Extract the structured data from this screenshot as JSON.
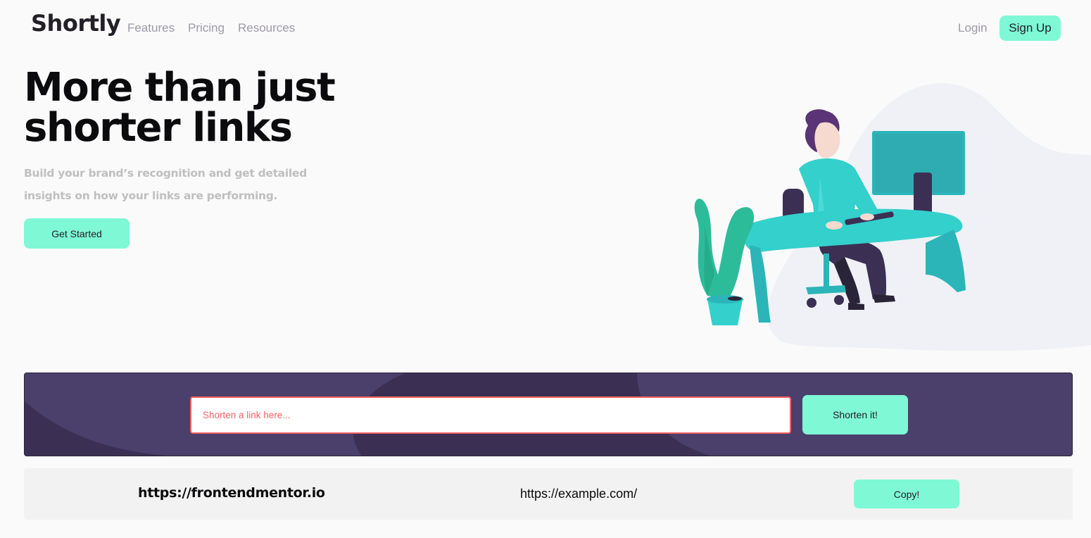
{
  "nav": {
    "logo": "Shortly",
    "links": [
      {
        "label": "Features"
      },
      {
        "label": "Pricing"
      },
      {
        "label": "Resources"
      }
    ],
    "login": "Login",
    "signup": "Sign Up"
  },
  "hero": {
    "title_line1": "More than just",
    "title_line2": "shorter links",
    "subtitle": "Build your brand’s recognition and get detailed insights on how your links are performing.",
    "cta": "Get Started",
    "illustration": "person-working-at-desk-illustration"
  },
  "shorten": {
    "placeholder": "Shorten a link here...",
    "value": "",
    "button": "Shorten it!"
  },
  "results": [
    {
      "original": "https://frontendmentor.io",
      "short": "https://example.com/",
      "copy": "Copy!"
    }
  ],
  "colors": {
    "accent": "#7ff8d5",
    "panel": "#4b3f6b",
    "error": "#f46363",
    "heading": "#0b0b0d",
    "muted": "#9e9aa7"
  }
}
